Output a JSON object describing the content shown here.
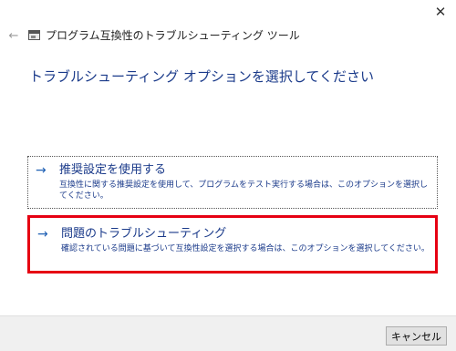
{
  "window": {
    "title": "プログラム互換性のトラブルシューティング ツール",
    "close_label": "✕",
    "back_label": "←"
  },
  "main": {
    "heading": "トラブルシューティング オプションを選択してください",
    "arrow_glyph": "→",
    "options": [
      {
        "title": "推奨設定を使用する",
        "description": "互換性に関する推奨設定を使用して、プログラムをテスト実行する場合は、このオプションを選択してください。",
        "highlighted": false
      },
      {
        "title": "問題のトラブルシューティング",
        "description": "確認されている問題に基づいて互換性設定を選択する場合は、このオプションを選択してください。",
        "highlighted": true,
        "highlight_color": "#e60012"
      }
    ]
  },
  "footer": {
    "cancel_label": "キャンセル"
  },
  "icons": {
    "app_icon": "program-window-icon",
    "back": "back-arrow-icon",
    "close": "close-icon",
    "option_arrow": "right-arrow-icon"
  },
  "colors": {
    "link_blue": "#1a3a8a",
    "arrow_blue": "#1e5fb4",
    "highlight_red": "#e60012",
    "footer_bg": "#f0f0f0"
  }
}
